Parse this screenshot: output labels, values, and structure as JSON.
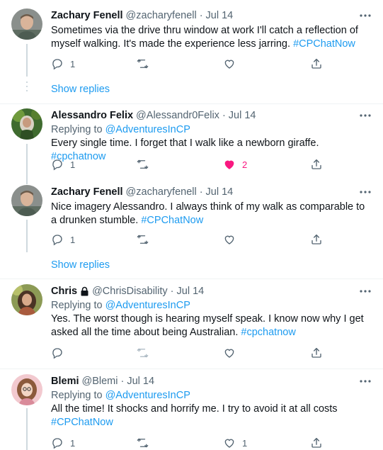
{
  "tweets": [
    {
      "name": "Zachary Fenell",
      "handle": "@zacharyfenell",
      "sep": "·",
      "time": "Jul 14",
      "replying_label": "",
      "replying_to": "",
      "text": "Sometimes via the drive thru window at work I'll catch a reflection of myself walking. It's made the experience less jarring. ",
      "hashtag": "#CPChatNow",
      "reply_count": "1",
      "like_count": "",
      "liked": false,
      "show_replies": "Show replies"
    },
    {
      "name": "Alessandro Felix",
      "handle": "@Alessandr0Felix",
      "sep": "·",
      "time": "Jul 14",
      "replying_label": "Replying to ",
      "replying_to": "@AdventuresInCP",
      "text": "Every single time. I forget that I walk like a newborn giraffe. ",
      "hashtag": "#cpchatnow",
      "reply_count": "1",
      "like_count": "2",
      "liked": true,
      "show_replies": ""
    },
    {
      "name": "Zachary Fenell",
      "handle": "@zacharyfenell",
      "sep": "·",
      "time": "Jul 14",
      "replying_label": "",
      "replying_to": "",
      "text": "Nice imagery Alessandro. I always think of my walk as comparable to a drunken stumble. ",
      "hashtag": "#CPChatNow",
      "reply_count": "1",
      "like_count": "",
      "liked": false,
      "show_replies": "Show replies"
    },
    {
      "name": "Chris",
      "handle": "@ChrisDisability",
      "sep": "·",
      "time": "Jul 14",
      "replying_label": "Replying to ",
      "replying_to": "@AdventuresInCP",
      "text": "Yes. The worst though is hearing myself speak. I know now why I get asked all the time about being Australian. ",
      "hashtag": "#cpchatnow",
      "reply_count": "",
      "like_count": "",
      "liked": false,
      "protected": true,
      "show_replies": ""
    },
    {
      "name": "Blemi",
      "handle": "@Blemi",
      "sep": "·",
      "time": "Jul 14",
      "replying_label": "Replying to ",
      "replying_to": "@AdventuresInCP",
      "text": "All the time! It shocks and horrify me. I try to avoid it at all costs ",
      "hashtag": "#CPChatNow",
      "reply_count": "1",
      "like_count": "1",
      "liked": false,
      "show_replies": ""
    }
  ],
  "colors": {
    "accent": "#1d9bf0",
    "liked": "#f91880",
    "muted": "#536471"
  },
  "icons": [
    "reply-icon",
    "retweet-icon",
    "like-icon",
    "share-icon",
    "more-icon",
    "lock-icon"
  ]
}
